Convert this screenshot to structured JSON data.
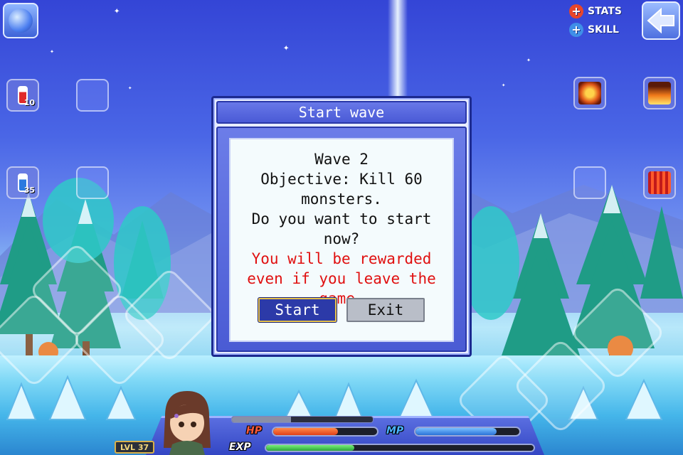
{
  "hud": {
    "stats_label": "STATS",
    "skill_label": "SKILL",
    "colors": {
      "stats_plus": "#e8462a",
      "skill_plus": "#3f8fe8"
    }
  },
  "quick_slots": {
    "left_top_potion": {
      "icon": "red-potion-icon",
      "count": "10"
    },
    "left_bottom_potion": {
      "icon": "blue-potion-icon",
      "count": "35"
    },
    "right_top_1": {
      "icon": "shield-skill-icon"
    },
    "right_top_2": {
      "icon": "flame-skill-icon"
    },
    "right_bottom_2": {
      "icon": "fire-wall-skill-icon"
    }
  },
  "dialog": {
    "title": "Start wave",
    "lines": [
      "Wave 2",
      "Objective: Kill 60",
      "monsters.",
      "Do you want to start",
      "now?"
    ],
    "warning_lines": [
      "You will be rewarded",
      "even if you leave the",
      "game."
    ],
    "start_label": "Start",
    "exit_label": "Exit",
    "colors": {
      "warning": "#e01010",
      "start_bg": "#2c3aa8"
    }
  },
  "player": {
    "level_label": "LVL 37",
    "hp_label": "HP",
    "mp_label": "MP",
    "exp_label": "EXP",
    "hp_fraction": 0.62,
    "mp_fraction": 0.78,
    "exp_fraction": 0.33,
    "gauge_fraction": 0.42,
    "colors": {
      "hp": "#f05a2a",
      "mp": "#4a8ee8",
      "exp": "#3cd048"
    }
  }
}
